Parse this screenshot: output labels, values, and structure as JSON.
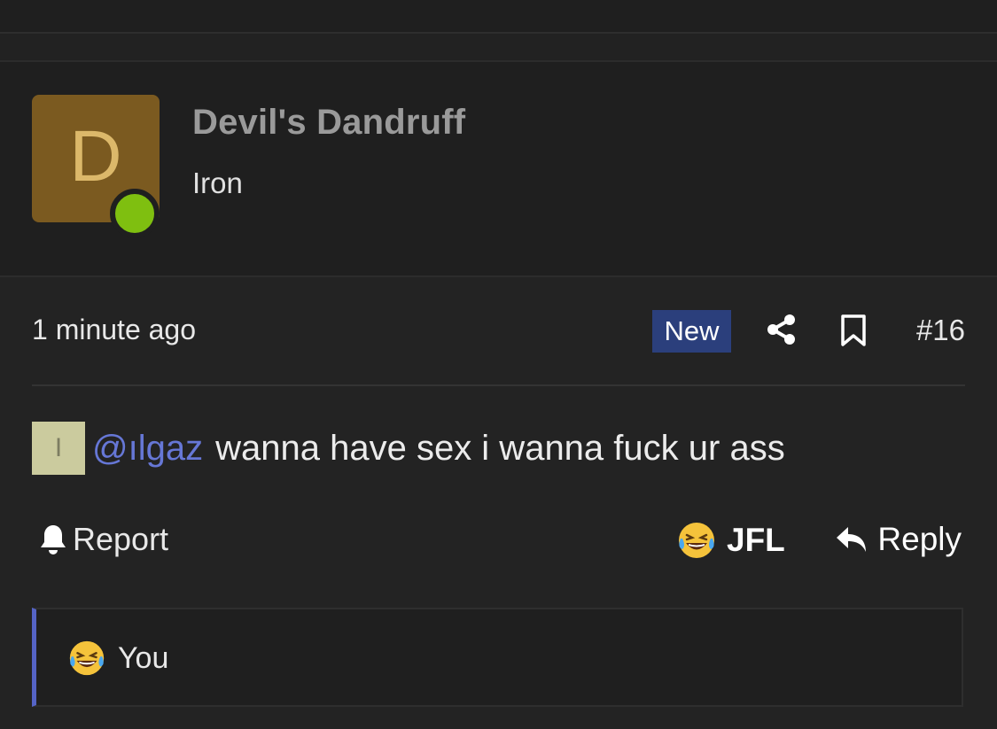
{
  "author": {
    "avatar_letter": "D",
    "avatar_color": "#7b5a20",
    "online_indicator_color": "#7fbf10",
    "name": "Devil's Dandruff",
    "rank": "Iron"
  },
  "post_meta": {
    "timestamp": "1 minute ago",
    "badge": "New",
    "badge_color": "#2b3f7c",
    "share_icon": "share-icon",
    "bookmark_icon": "bookmark-icon",
    "post_number": "#16"
  },
  "post_body": {
    "mention_avatar_letter": "I",
    "mention": "@ılgaz",
    "text": "wanna have sex i wanna fuck ur ass"
  },
  "actions": {
    "report_label": "Report",
    "report_icon": "bell-icon",
    "reaction_icon": "laughing-crying-emoji-icon",
    "reaction_label": "JFL",
    "reply_icon": "reply-arrow-icon",
    "reply_label": "Reply"
  },
  "reactions": {
    "icon": "laughing-crying-emoji-icon",
    "users_label": "You"
  }
}
